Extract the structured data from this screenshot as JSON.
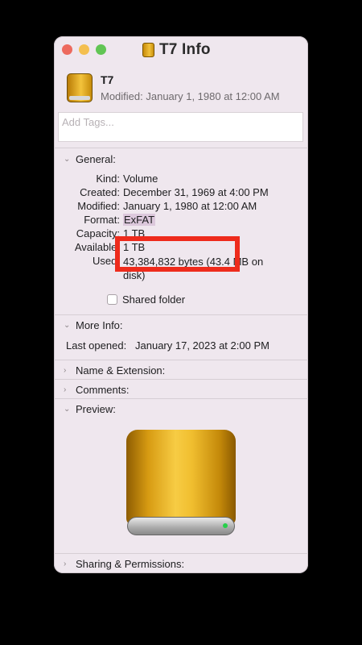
{
  "window": {
    "title": "T7 Info"
  },
  "header": {
    "name": "T7",
    "modified": "Modified: January 1, 1980 at 12:00 AM"
  },
  "tags": {
    "placeholder": "Add Tags..."
  },
  "sections": {
    "general": "General:",
    "more_info": "More Info:",
    "name_extension": "Name & Extension:",
    "comments": "Comments:",
    "preview": "Preview:",
    "sharing": "Sharing & Permissions:"
  },
  "general": {
    "kind_label": "Kind:",
    "kind_value": "Volume",
    "created_label": "Created:",
    "created_value": "December 31, 1969 at 4:00 PM",
    "modified_label": "Modified:",
    "modified_value": "January 1, 1980 at 12:00 AM",
    "format_label": "Format:",
    "format_value": "ExFAT",
    "capacity_label": "Capacity:",
    "capacity_value": "1 TB",
    "available_label": "Available:",
    "available_value": "1 TB",
    "used_label": "Used:",
    "used_value": "43,384,832 bytes (43.4 MB on disk)",
    "shared_folder": "Shared folder"
  },
  "more_info": {
    "last_opened_label": "Last opened:",
    "last_opened_value": "January 17, 2023 at 2:00 PM"
  },
  "colors": {
    "annotation": "#ee2b1c",
    "window_bg": "#efe7ee"
  },
  "icons": {
    "drive": "external-drive-icon",
    "expanded": "chevron-down-icon",
    "collapsed": "chevron-right-icon"
  }
}
